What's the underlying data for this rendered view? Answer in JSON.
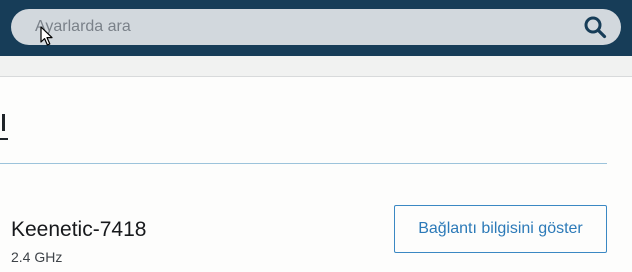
{
  "search": {
    "placeholder": "Ayarlarda ara",
    "value": ""
  },
  "network": {
    "name": "Keenetic-7418",
    "band": "2.4 GHz"
  },
  "actions": {
    "show_connection_info": "Bağlantı bilgisini göster"
  },
  "icons": {
    "search": "search-icon",
    "cursor": "mouse-pointer-icon"
  },
  "colors": {
    "header": "#173d58",
    "search_field": "#d2d8dd",
    "accent": "#2c7ab8",
    "divider": "#9cc3db"
  }
}
